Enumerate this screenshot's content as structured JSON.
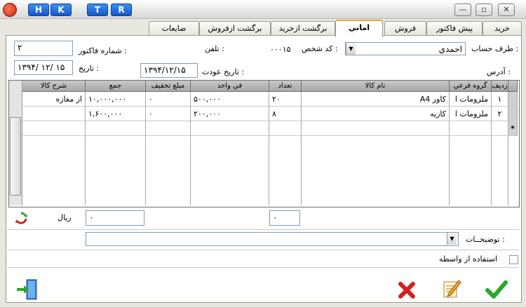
{
  "titlebar": {
    "letters": [
      "H",
      "K",
      "T",
      "R"
    ],
    "window_buttons": [
      "—",
      "▫",
      "✕"
    ]
  },
  "tabs": [
    {
      "label": "خريد",
      "active": false
    },
    {
      "label": "پيش فاكتور",
      "active": false
    },
    {
      "label": "فروش",
      "active": false
    },
    {
      "label": "اماني",
      "active": true
    },
    {
      "label": "برگشت ازخريد",
      "active": false
    },
    {
      "label": "برگشت ازفروش",
      "active": false
    },
    {
      "label": "ضايعات",
      "active": false
    }
  ],
  "form": {
    "account_label": "طرف حساب :",
    "account_value": "احمدي",
    "person_code_label": "كد شخص :",
    "person_code_value": "۰۰۰۱۵",
    "phone_label": "تلفن :",
    "invoice_no_label": "شماره فاكتور :",
    "invoice_no_value": "۲",
    "address_label": "آدرس :",
    "return_date_label": "تاريخ عودت :",
    "return_date_value": "۱۳۹۴/۱۲/۱۵",
    "date_label": "تاريخ :",
    "date_value": "۱۳۹۴/ ۱۲/ ۱۵"
  },
  "grid": {
    "columns": [
      "رديف",
      "گروه فرعي",
      "نام كالا",
      "تعداد",
      "في واحد",
      "مبلغ تخفيف",
      "جمع",
      "شرح كالا"
    ],
    "rows": [
      {
        "row_no": "۱",
        "group": "ملزومات ا",
        "name": "A4 كاور",
        "qty": "۲۰",
        "unit_price": "۵۰۰,۰۰۰",
        "discount": "۰",
        "total": "۱۰,۰۰۰,۰۰۰",
        "desc": "از مغازه"
      },
      {
        "row_no": "۲",
        "group": "ملزومات ا",
        "name": "كازيه",
        "qty": "۸",
        "unit_price": "۲۰۰,۰۰۰",
        "discount": "۰",
        "total": "۱,۶۰۰,۰۰۰",
        "desc": ""
      }
    ],
    "new_row_marker": "*"
  },
  "totals": {
    "qty_total": "۰",
    "sum_total": "۰",
    "currency_label": "ريال"
  },
  "notes_label": "توضيحــات :",
  "broker_label": "استفاده از واسطه",
  "icons": {
    "check": "check-icon",
    "edit": "edit-icon",
    "cancel": "cancel-icon",
    "exit": "exit-door-icon",
    "refresh": "refresh-icon"
  },
  "colors": {
    "accent": "#1556c9",
    "check": "#2aa82a",
    "cancel": "#d42020"
  }
}
